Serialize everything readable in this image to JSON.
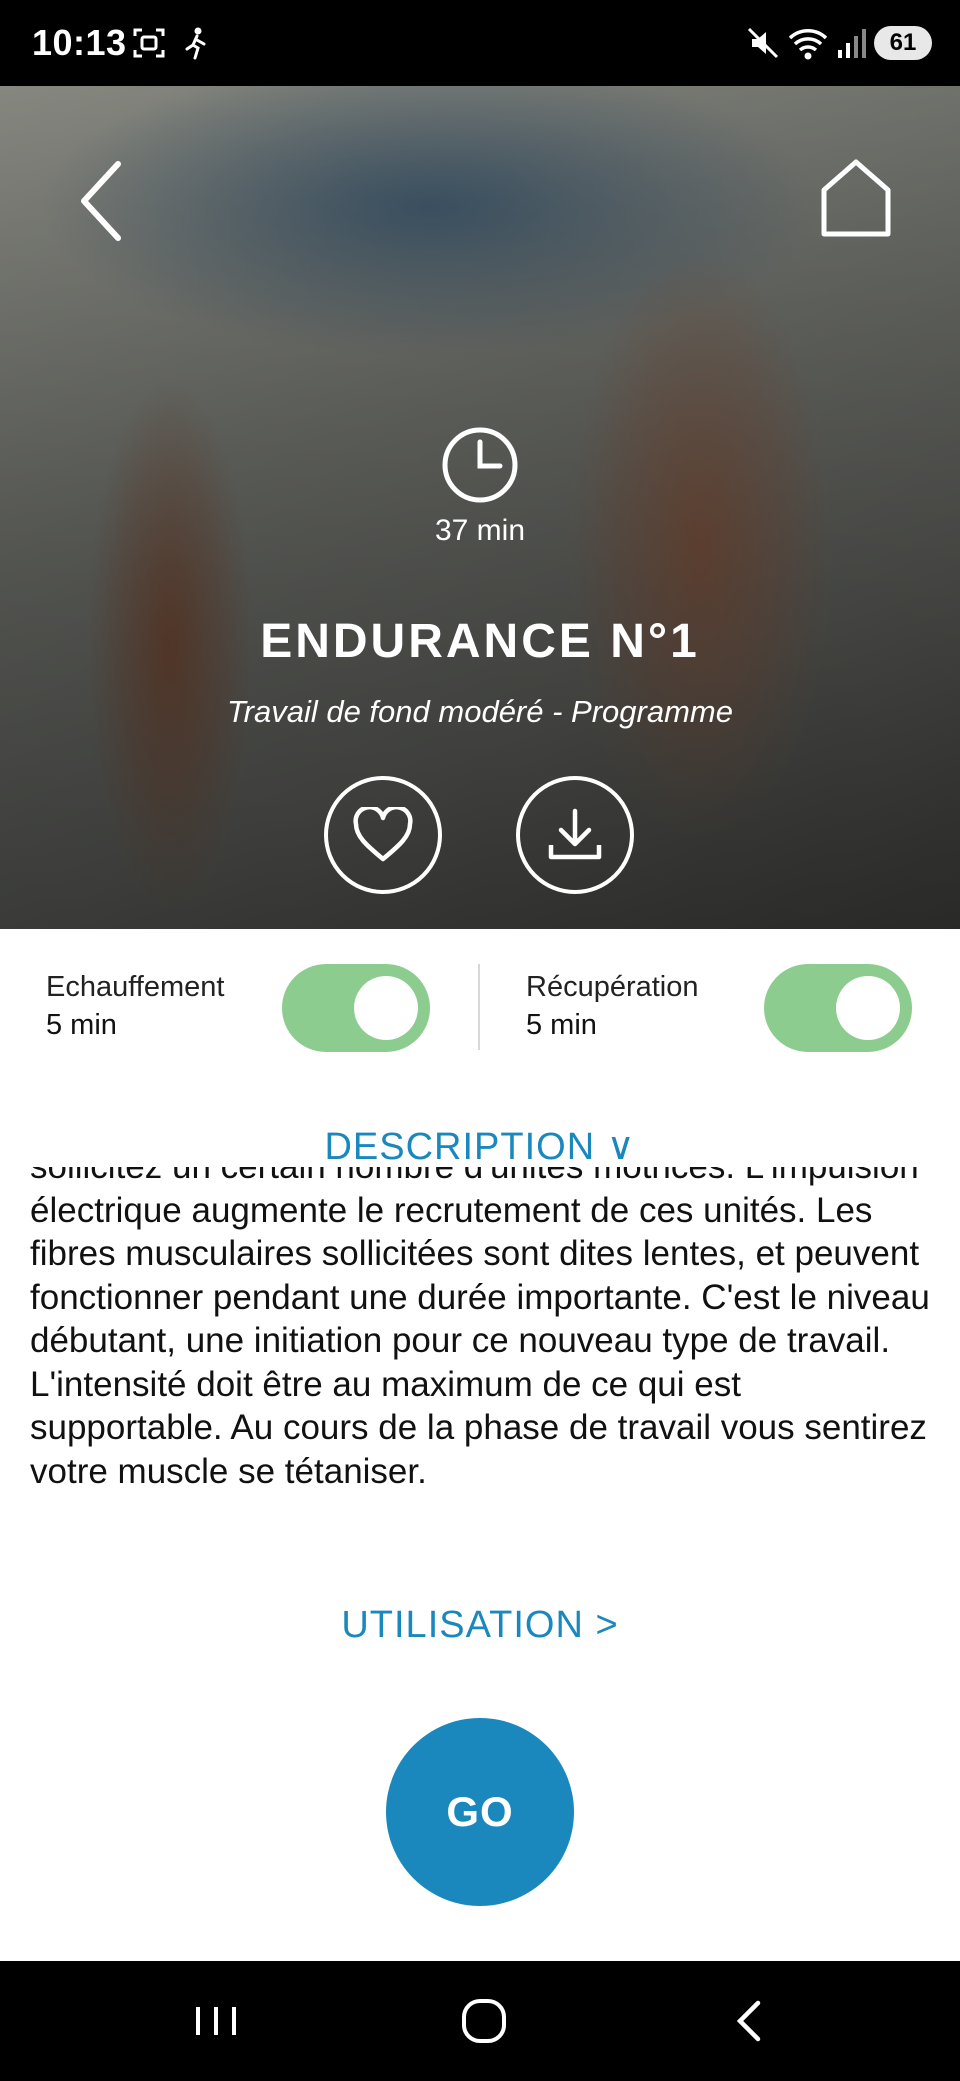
{
  "status_bar": {
    "time": "10:13",
    "battery": "61",
    "icons": [
      "screenshot-icon",
      "accessibility-icon",
      "mute-icon",
      "wifi-icon",
      "signal-icon",
      "battery-icon"
    ]
  },
  "hero": {
    "duration": "37 min",
    "title": "ENDURANCE N°1",
    "subtitle": "Travail de fond modéré - Programme",
    "icons": [
      "back-arrow-icon",
      "home-icon",
      "clock-icon",
      "heart-icon",
      "download-icon"
    ]
  },
  "toggles": {
    "warmup": {
      "label": "Echauffement",
      "value": "5 min",
      "on": true
    },
    "recovery": {
      "label": "Récupération",
      "value": "5 min",
      "on": true
    },
    "on_color": "#8dcc8f"
  },
  "description": {
    "header": "DESCRIPTION ∨",
    "text": "sollicitez un certain nombre d'unités motrices. L'impulsion électrique augmente le recrutement de ces unités. Les fibres musculaires sollicitées sont dites lentes, et peuvent fonctionner pendant une durée importante. C'est le niveau débutant, une initiation pour ce nouveau type de travail. L'intensité doit être au maximum de ce qui est supportable. Au cours de la phase de travail vous sentirez votre muscle se tétaniser."
  },
  "usage": {
    "label": "UTILISATION >"
  },
  "go": {
    "label": "GO"
  },
  "colors": {
    "accent": "#1a88bd",
    "status_bg": "#000000"
  },
  "android_nav": {
    "icons": [
      "recents-icon",
      "home-circle-icon",
      "back-chevron-icon"
    ]
  }
}
